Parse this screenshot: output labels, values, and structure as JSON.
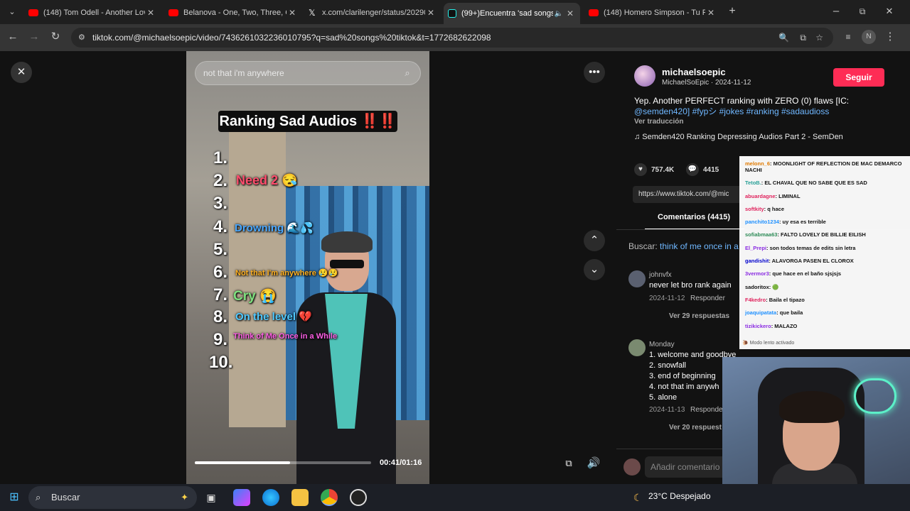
{
  "browser": {
    "tabs": [
      {
        "title": "(148) Tom Odell - Another Love",
        "color": "#ff0000"
      },
      {
        "title": "Belanova - One, Two, Three, GO",
        "color": "#ff0000"
      },
      {
        "title": "x.com/clarilenger/status/20290",
        "color": "#ffffff"
      },
      {
        "title": "(99+)Encuentra 'sad songs",
        "color": "#25f4ee"
      },
      {
        "title": "(148) Homero Simpson - Tu Fal",
        "color": "#ff0000"
      }
    ],
    "url": "tiktok.com/@michaelsoepic/video/7436261032236010795?q=sad%20songs%20tiktok&t=1772682622098",
    "profile_initial": "N"
  },
  "video": {
    "search_text": "not that i'm anywhere",
    "title": "Ranking Sad Audios ‼️‼️",
    "ranks": [
      "1.",
      "2.",
      "3.",
      "4.",
      "5.",
      "6.",
      "7.",
      "8.",
      "9.",
      "10."
    ],
    "items": [
      {
        "text": "Need 2 😪",
        "color": "#ff4d6d"
      },
      {
        "text": "Drowning 🌊💦",
        "color": "#4aa8ff"
      },
      {
        "text": "Not that I'm anywhere 😢😢",
        "color": "#ffb020"
      },
      {
        "text": "Cry 😭",
        "color": "#7ee07e"
      },
      {
        "text": "On the level 💔",
        "color": "#4fc9ff"
      },
      {
        "text": "Think of Me Once in a While",
        "color": "#ff5ee6"
      }
    ],
    "time": "00:41/01:16",
    "progress": 0.54
  },
  "post": {
    "username": "michaelsoepic",
    "handle_date": "MichaelSoEpic · 2024-11-12",
    "follow_label": "Seguir",
    "caption_text": "Yep. Another PERFECT ranking with ZERO (0) flaws [IC:",
    "caption_tags": "@semden420] #fypシ #jokes #ranking #sadaudioss",
    "translate": "Ver traducción",
    "music": "♫  Semden420 Ranking Depressing Audios Part 2 - SemDen",
    "likes": "757.4K",
    "comments_count": "4415",
    "link": "https://www.tiktok.com/@mic",
    "comments_tab": "Comentarios (4415)",
    "search_label": "Buscar:",
    "search_query": "think of me once in a"
  },
  "comments": [
    {
      "name": "johnvfx",
      "text": "never let bro rank again",
      "date": "2024-11-12",
      "reply": "Responder",
      "replies": "Ver 29 respuestas"
    },
    {
      "name": "Monday",
      "lines": [
        "1. welcome and goodbye",
        "2. snowfall",
        "3. end of beginning",
        "4. not that im anywh",
        "5. alone"
      ],
      "date": "2024-11-13",
      "reply": "Responder",
      "replies": "Ver 20 respuest"
    }
  ],
  "add_comment_placeholder": "Añadir comentario",
  "chat": [
    {
      "user": "melonn_6",
      "color": "#e07a00",
      "msg": "MOONLIGHT OF REFLECTION DE MAC DEMARCO NACHI"
    },
    {
      "user": "TetoB.",
      "color": "#2aa198",
      "msg": "EL CHAVAL QUE NO SABE QUE ES SAD"
    },
    {
      "user": "abuardagne",
      "color": "#e0245e",
      "msg": "LIMINAL"
    },
    {
      "user": "softkity",
      "color": "#e0245e",
      "msg": "q hace"
    },
    {
      "user": "panchito1234",
      "color": "#1e90ff",
      "msg": "uy esa es terrible"
    },
    {
      "user": "sofiabmaa63",
      "color": "#2e8b57",
      "msg": "FALTO LOVELY DE BILLIE EILISH"
    },
    {
      "user": "El_Prepi",
      "color": "#8a2be2",
      "msg": "son todos temas de edits sin letra"
    },
    {
      "user": "gandishit",
      "color": "#0000cd",
      "msg": "ALAVORGA PASEN EL CLOROX"
    },
    {
      "user": "3vermor3",
      "color": "#8a2be2",
      "msg": "que hace en el baño sjsjsjs"
    },
    {
      "user": "sadoritox",
      "color": "#111111",
      "msg": "🟢"
    },
    {
      "user": "F4kedro",
      "color": "#e0245e",
      "msg": "Baila el tipazo"
    },
    {
      "user": "joaquipatata",
      "color": "#1e90ff",
      "msg": "que baila"
    },
    {
      "user": "tizikickero",
      "color": "#8a2be2",
      "msg": "MALAZO"
    }
  ],
  "chat_footer": "Modo lento activado",
  "taskbar": {
    "search": "Buscar",
    "weather": "23°C  Despejado"
  }
}
